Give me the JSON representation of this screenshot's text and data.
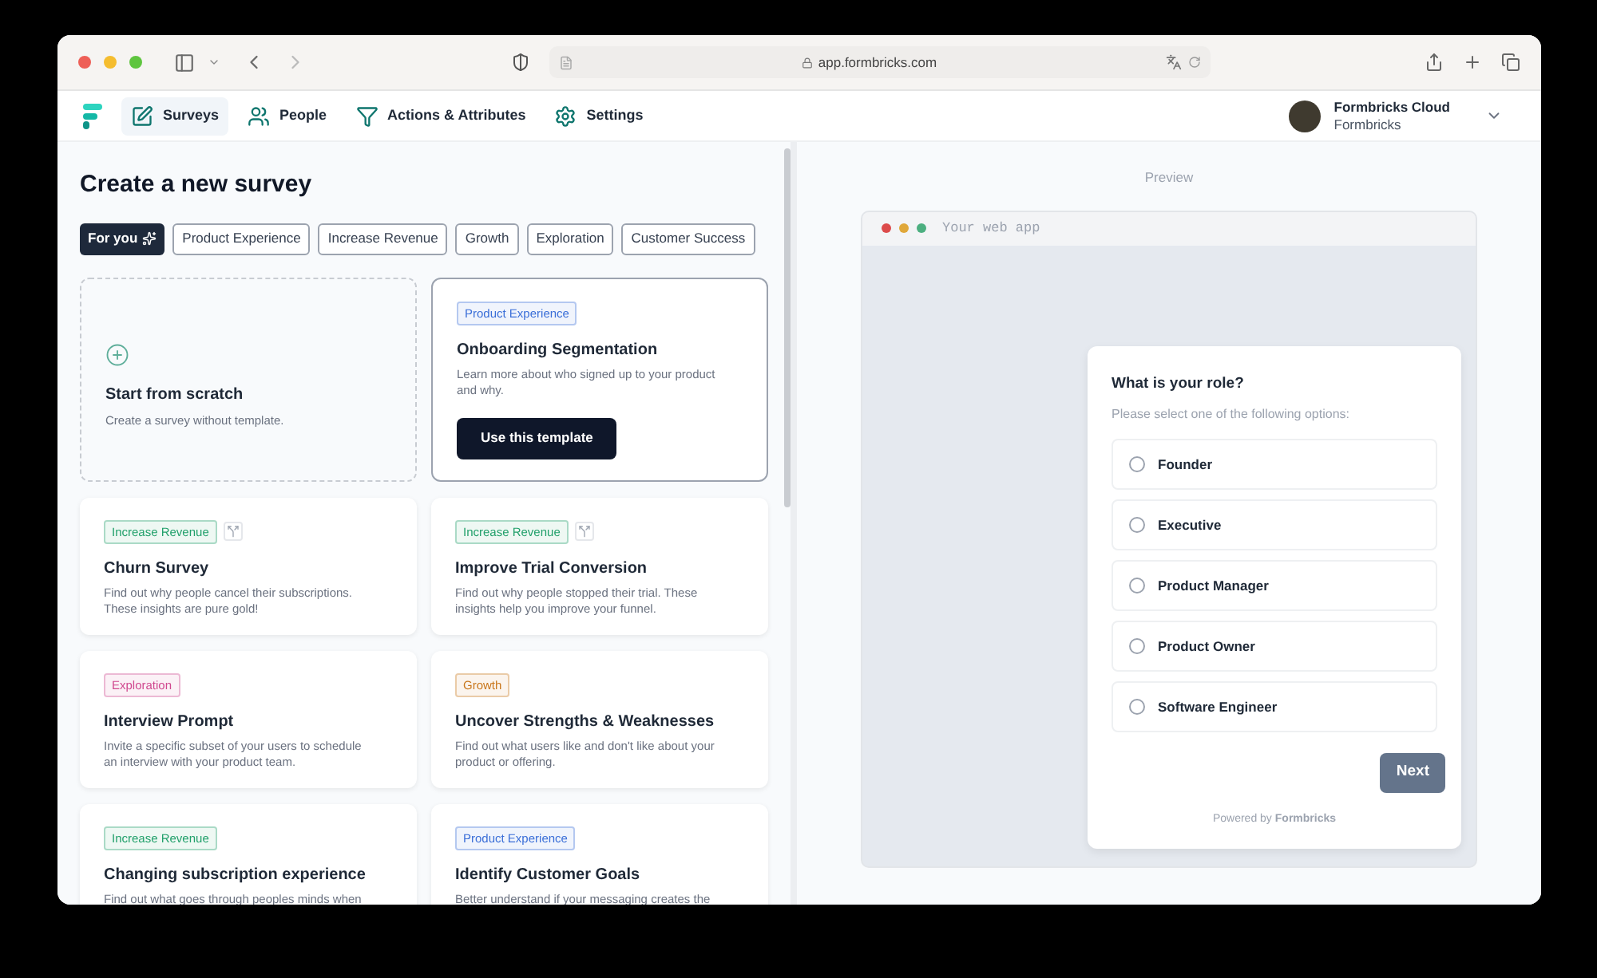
{
  "browser": {
    "url": "app.formbricks.com"
  },
  "nav": [
    {
      "kind": "surveys",
      "label": "Surveys",
      "selected": true
    },
    {
      "kind": "people",
      "label": "People",
      "selected": false
    },
    {
      "kind": "actions",
      "label": "Actions & Attributes",
      "selected": false
    },
    {
      "kind": "settings",
      "label": "Settings",
      "selected": false
    }
  ],
  "account": {
    "name": "Formbricks Cloud",
    "organization": "Formbricks"
  },
  "page_title": "Create a new survey",
  "filters": [
    {
      "label": "For you",
      "selected": true
    },
    {
      "label": "Product Experience",
      "selected": false
    },
    {
      "label": "Increase Revenue",
      "selected": false
    },
    {
      "label": "Growth",
      "selected": false
    },
    {
      "label": "Exploration",
      "selected": false
    },
    {
      "label": "Customer Success",
      "selected": false
    }
  ],
  "scratch": {
    "title": "Start from scratch",
    "description": "Create a survey without template."
  },
  "templates": [
    {
      "tag": "Product Experience",
      "color": "#3b6fd8",
      "branching": false,
      "selected": true,
      "title": "Onboarding Segmentation",
      "description": "Learn more about who signed up to your product and why.",
      "button": "Use this template"
    },
    {
      "tag": "Increase Revenue",
      "color": "#22a06b",
      "branching": true,
      "selected": false,
      "title": "Churn Survey",
      "description": "Find out why people cancel their subscriptions. These insights are pure gold!"
    },
    {
      "tag": "Increase Revenue",
      "color": "#22a06b",
      "branching": true,
      "selected": false,
      "title": "Improve Trial Conversion",
      "description": "Find out why people stopped their trial. These insights help you improve your funnel."
    },
    {
      "tag": "Exploration",
      "color": "#d0498f",
      "branching": false,
      "selected": false,
      "title": "Interview Prompt",
      "description": "Invite a specific subset of your users to schedule an interview with your product team."
    },
    {
      "tag": "Growth",
      "color": "#c9771c",
      "branching": false,
      "selected": false,
      "title": "Uncover Strengths & Weaknesses",
      "description": "Find out what users like and don't like about your product or offering."
    },
    {
      "tag": "Increase Revenue",
      "color": "#22a06b",
      "branching": false,
      "selected": false,
      "title": "Changing subscription experience",
      "description": "Find out what goes through peoples minds when"
    },
    {
      "tag": "Product Experience",
      "color": "#3b6fd8",
      "branching": false,
      "selected": false,
      "title": "Identify Customer Goals",
      "description": "Better understand if your messaging creates the"
    }
  ],
  "preview": {
    "label": "Preview",
    "window_title": "Your web app",
    "question": "What is your role?",
    "subtitle": "Please select one of the following options:",
    "options": [
      {
        "label": "Founder",
        "selected": false
      },
      {
        "label": "Executive",
        "selected": false
      },
      {
        "label": "Product Manager",
        "selected": false
      },
      {
        "label": "Product Owner",
        "selected": false
      },
      {
        "label": "Software Engineer",
        "selected": false
      }
    ],
    "button": "Next",
    "powered_by": "Powered by **Formbricks**"
  }
}
